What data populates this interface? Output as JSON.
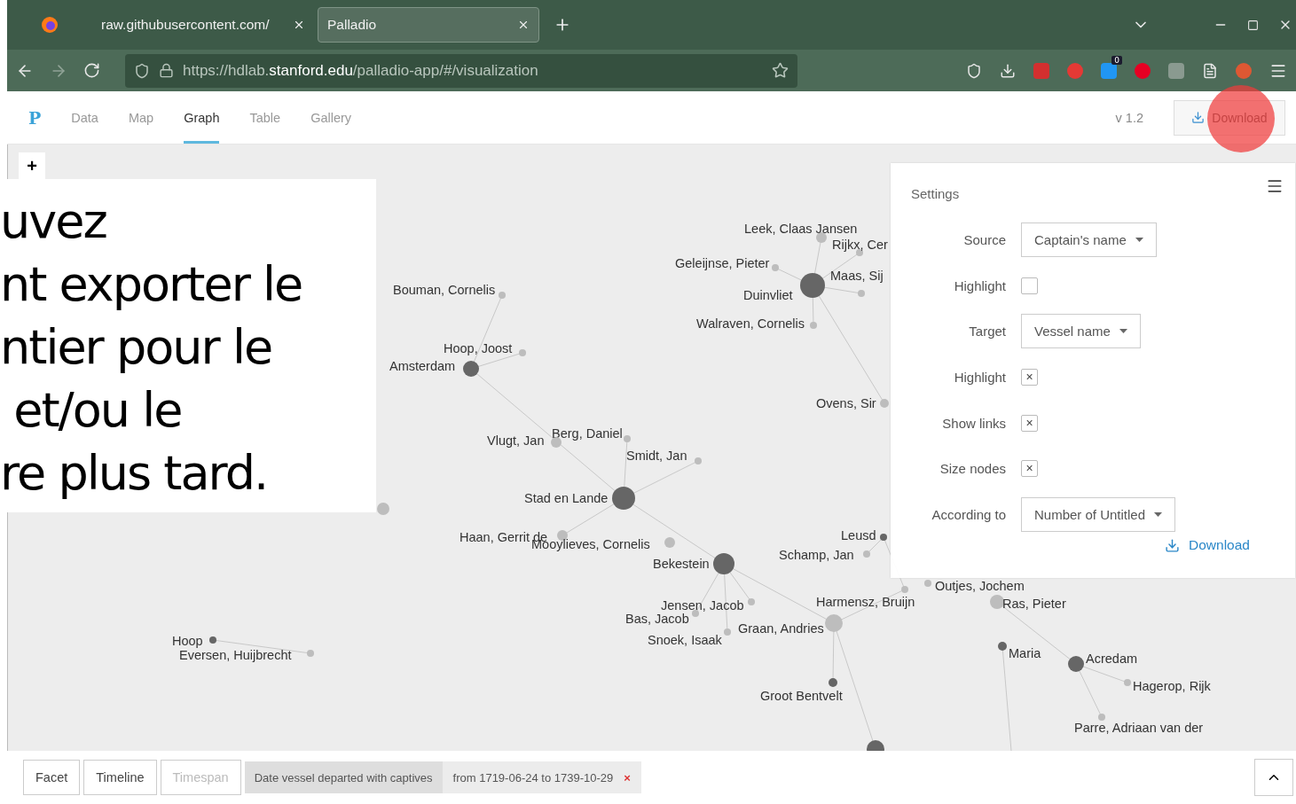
{
  "browser": {
    "tabs": [
      {
        "title": "raw.githubusercontent.com/",
        "selected": false
      },
      {
        "title": "Palladio",
        "selected": true
      }
    ],
    "url_prefix": "https://hdlab.",
    "url_domain": "stanford.edu",
    "url_path": "/palladio-app/#/visualization",
    "extension_badge": "0"
  },
  "app": {
    "logo": "P",
    "nav": [
      {
        "label": "Data",
        "selected": false
      },
      {
        "label": "Map",
        "selected": false
      },
      {
        "label": "Graph",
        "selected": true
      },
      {
        "label": "Table",
        "selected": false
      },
      {
        "label": "Gallery",
        "selected": false
      }
    ],
    "version": "v 1.2",
    "download": "Download"
  },
  "graph": {
    "add_button": "+",
    "nodes": [
      {
        "label": "Leek, Claas Jansen",
        "kind": "captain"
      },
      {
        "label": "Rijkx, Cer",
        "kind": "captain"
      },
      {
        "label": "Geleijnse, Pieter",
        "kind": "captain"
      },
      {
        "label": "Duinvliet",
        "kind": "vessel"
      },
      {
        "label": "Maas, Sij",
        "kind": "captain"
      },
      {
        "label": "Bouman, Cornelis",
        "kind": "captain"
      },
      {
        "label": "Walraven, Cornelis",
        "kind": "captain"
      },
      {
        "label": "Hoop, Joost",
        "kind": "captain"
      },
      {
        "label": "Amsterdam",
        "kind": "vessel"
      },
      {
        "label": "Ovens, Sir",
        "kind": "captain"
      },
      {
        "label": "Berg, Daniel",
        "kind": "captain"
      },
      {
        "label": "Vlugt, Jan",
        "kind": "captain"
      },
      {
        "label": "Smidt, Jan",
        "kind": "captain"
      },
      {
        "label": "Stad en Lande",
        "kind": "vessel"
      },
      {
        "label": "Haan, Gerrit de",
        "kind": "captain"
      },
      {
        "label": "Leusd",
        "kind": "vessel"
      },
      {
        "label": "Mooylieves, Cornelis",
        "kind": "captain"
      },
      {
        "label": "Schamp, Jan",
        "kind": "captain"
      },
      {
        "label": "Bekestein",
        "kind": "vessel"
      },
      {
        "label": "Outjes, Jochem",
        "kind": "captain"
      },
      {
        "label": "Jensen, Jacob",
        "kind": "captain"
      },
      {
        "label": "Harmensz, Bruijn",
        "kind": "captain"
      },
      {
        "label": "Ras, Pieter",
        "kind": "captain"
      },
      {
        "label": "Bas, Jacob",
        "kind": "captain"
      },
      {
        "label": "Graan, Andries",
        "kind": "captain"
      },
      {
        "label": "Hoop",
        "kind": "vessel"
      },
      {
        "label": "Snoek, Isaak",
        "kind": "captain"
      },
      {
        "label": "Eversen, Huijbrecht",
        "kind": "captain"
      },
      {
        "label": "Maria",
        "kind": "vessel"
      },
      {
        "label": "Acredam",
        "kind": "vessel"
      },
      {
        "label": "Hagerop, Rijk",
        "kind": "captain"
      },
      {
        "label": "Groot Bentvelt",
        "kind": "vessel"
      },
      {
        "label": "Parre, Adriaan van der",
        "kind": "captain"
      }
    ]
  },
  "overlay": {
    "lines": [
      "uvez",
      "nt exporter le",
      "ntier pour le",
      "et/ou le",
      "re plus tard."
    ]
  },
  "settings": {
    "title": "Settings",
    "rows": [
      {
        "kind": "select",
        "label": "Source",
        "value": "Captain's name"
      },
      {
        "kind": "checkbox",
        "label": "Highlight",
        "checked": false
      },
      {
        "kind": "select",
        "label": "Target",
        "value": "Vessel name"
      },
      {
        "kind": "checkbox",
        "label": "Highlight",
        "checked": true
      },
      {
        "kind": "checkbox",
        "label": "Show links",
        "checked": true
      },
      {
        "kind": "checkbox",
        "label": "Size nodes",
        "checked": true
      },
      {
        "kind": "select",
        "label": "According to",
        "value": "Number of Untitled"
      }
    ],
    "check_mark": "×",
    "download": "Download"
  },
  "bottom": {
    "buttons": [
      {
        "label": "Facet",
        "disabled": false
      },
      {
        "label": "Timeline",
        "disabled": false
      },
      {
        "label": "Timespan",
        "disabled": true
      }
    ],
    "filter": {
      "name": "Date vessel departed with captives",
      "range": "from 1719-06-24 to 1739-10-29",
      "remove": "×"
    }
  }
}
